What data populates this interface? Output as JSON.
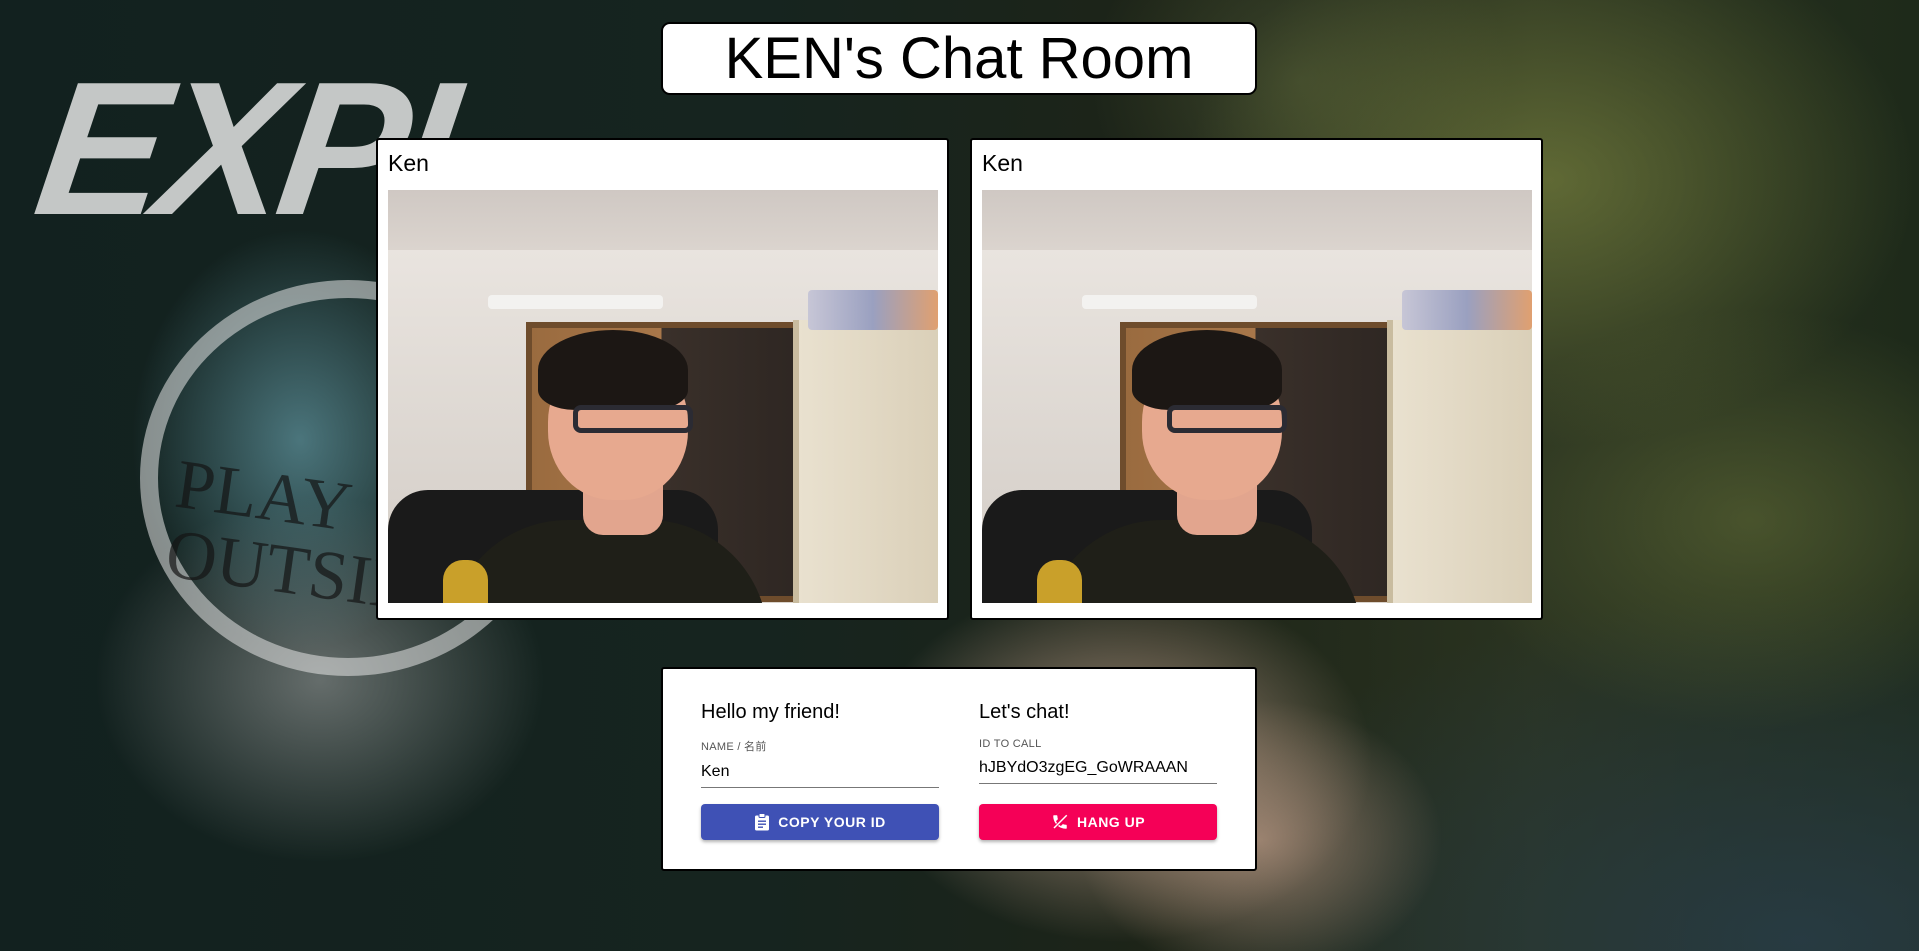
{
  "header": {
    "title": "KEN's Chat Room"
  },
  "videos": [
    {
      "name": "Ken"
    },
    {
      "name": "Ken"
    }
  ],
  "panel": {
    "left": {
      "heading": "Hello my friend!",
      "field_label": "NAME / 名前",
      "field_value": "Ken",
      "button_label": "COPY YOUR ID",
      "button_icon": "clipboard-icon"
    },
    "right": {
      "heading": "Let's chat!",
      "field_label": "ID TO CALL",
      "field_value": "hJBYdO3zgEG_GoWRAAAN",
      "button_label": "HANG UP",
      "button_icon": "phone-disabled-icon"
    }
  },
  "colors": {
    "copy_button": "#3f51b5",
    "hangup_button": "#f50057"
  }
}
